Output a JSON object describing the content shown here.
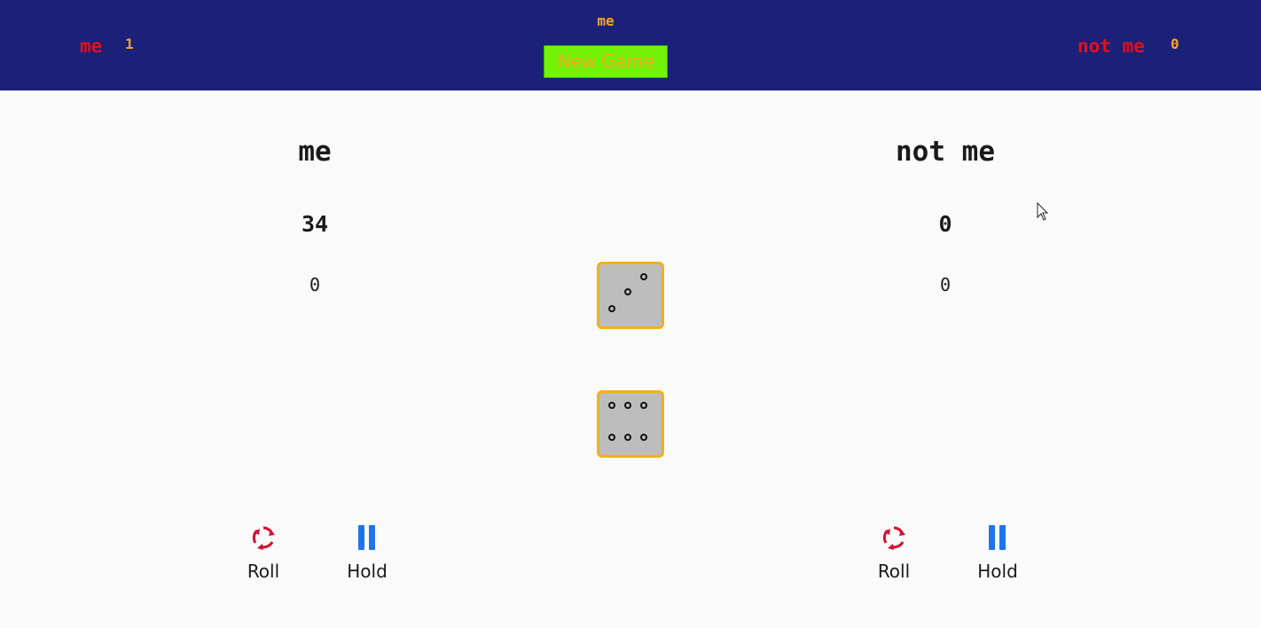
{
  "header": {
    "left_player_name": "me",
    "left_player_wins": "1",
    "current_player": "me",
    "new_game_label": "New Game",
    "right_player_name": "not me",
    "right_player_wins": "0"
  },
  "players": [
    {
      "name": "me",
      "total_score": "34",
      "current_score": "0",
      "roll_label": "Roll",
      "hold_label": "Hold"
    },
    {
      "name": "not me",
      "total_score": "0",
      "current_score": "0",
      "roll_label": "Roll",
      "hold_label": "Hold"
    }
  ],
  "dice": [
    {
      "value": 3
    },
    {
      "value": 6
    }
  ],
  "icons": {
    "roll": "refresh-icon",
    "hold": "pause-icon"
  },
  "colors": {
    "header_bg": "#1b2079",
    "header_name": "#e0101c",
    "header_score": "#f5a623",
    "new_game_bg": "#73f207",
    "die_border": "#f5b014",
    "die_face": "#bdbdbd",
    "roll_icon": "#d4102e",
    "hold_icon": "#1e74f0"
  }
}
